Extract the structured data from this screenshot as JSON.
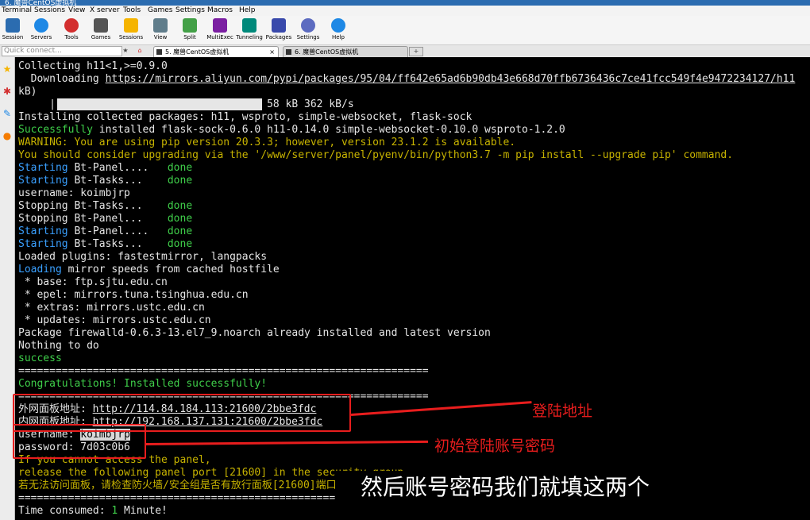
{
  "window": {
    "title": "6. 魔兽CentOS虚拟机"
  },
  "menu": [
    "Terminal",
    "Sessions",
    "View",
    "X server",
    "Tools",
    "Games",
    "Settings",
    "Macros",
    "Help"
  ],
  "toolbar": [
    {
      "label": "Session",
      "icon": "session-icon",
      "color": "#2b6cb0"
    },
    {
      "label": "Servers",
      "icon": "servers-icon",
      "color": "#1e88e5"
    },
    {
      "label": "Tools",
      "icon": "tools-icon",
      "color": "#d32f2f"
    },
    {
      "label": "Games",
      "icon": "games-icon",
      "color": "#555555"
    },
    {
      "label": "Sessions",
      "icon": "star-icon",
      "color": "#f5b400"
    },
    {
      "label": "View",
      "icon": "view-icon",
      "color": "#607d8b"
    },
    {
      "label": "Split",
      "icon": "split-icon",
      "color": "#43a047"
    },
    {
      "label": "MultiExec",
      "icon": "multiexec-icon",
      "color": "#7b1fa2"
    },
    {
      "label": "Tunneling",
      "icon": "tunneling-icon",
      "color": "#00897b"
    },
    {
      "label": "Packages",
      "icon": "packages-icon",
      "color": "#3949ab"
    },
    {
      "label": "Settings",
      "icon": "settings-icon",
      "color": "#5c6bc0"
    },
    {
      "label": "Help",
      "icon": "help-icon",
      "color": "#1e88e5"
    }
  ],
  "quick_connect": {
    "placeholder": "Quick connect..."
  },
  "tabs": [
    {
      "label": "5. 魔兽CentOS虚拟机",
      "active": true
    },
    {
      "label": "6. 魔兽CentOS虚拟机",
      "active": false
    }
  ],
  "terminal": {
    "lines": [
      {
        "text": "Collecting h11<1,>=0.9.0",
        "color": "w"
      },
      {
        "text": "  Downloading https://mirrors.aliyun.com/pypi/packages/95/04/ff642e65ad6b90db43e668d70ffb6736436c7ce41fcc549f4e9472234127/h11",
        "color": "w"
      },
      {
        "text": "kB)",
        "color": "w"
      },
      {
        "text": "     |                                | 58 kB 362 kB/s",
        "color": "w"
      },
      {
        "text": "Installing collected packages: h11, wsproto, simple-websocket, flask-sock",
        "color": "w"
      },
      {
        "text": "Successfully installed flask-sock-0.6.0 h11-0.14.0 simple-websocket-0.10.0 wsproto-1.2.0",
        "color": "w"
      },
      {
        "text": "WARNING: You are using pip version 20.3.3; however, version 23.1.2 is available.",
        "color": "y"
      },
      {
        "text": "You should consider upgrading via the '/www/server/panel/pyenv/bin/python3.7 -m pip install --upgrade pip' command.",
        "color": "y"
      },
      {
        "text": "Starting Bt-Panel....   done",
        "color": "w"
      },
      {
        "text": "Starting Bt-Tasks...    done",
        "color": "w"
      },
      {
        "text": "username: koimbjrp",
        "color": "w"
      },
      {
        "text": "Stopping Bt-Tasks...    done",
        "color": "w"
      },
      {
        "text": "Stopping Bt-Panel...    done",
        "color": "w"
      },
      {
        "text": "Starting Bt-Panel....   done",
        "color": "w"
      },
      {
        "text": "Starting Bt-Tasks...    done",
        "color": "w"
      },
      {
        "text": "Loaded plugins: fastestmirror, langpacks",
        "color": "w"
      },
      {
        "text": "Loading mirror speeds from cached hostfile",
        "color": "w"
      },
      {
        "text": " * base: ftp.sjtu.edu.cn",
        "color": "w"
      },
      {
        "text": " * epel: mirrors.tuna.tsinghua.edu.cn",
        "color": "w"
      },
      {
        "text": " * extras: mirrors.ustc.edu.cn",
        "color": "w"
      },
      {
        "text": " * updates: mirrors.ustc.edu.cn",
        "color": "w"
      },
      {
        "text": "Package firewalld-0.6.3-13.el7_9.noarch already installed and latest version",
        "color": "w"
      },
      {
        "text": "Nothing to do",
        "color": "w"
      },
      {
        "text": "success",
        "color": "g"
      },
      {
        "text": "==================================================================",
        "color": "w"
      },
      {
        "text": "Congratulations! Installed successfully!",
        "color": "g"
      },
      {
        "text": "==================================================================",
        "color": "w"
      },
      {
        "text": "外网面板地址: http://114.84.184.113:21600/2bbe3fdc",
        "color": "w"
      },
      {
        "text": "内网面板地址: http://192.168.137.131:21600/2bbe3fdc",
        "color": "w"
      },
      {
        "text": "username: koimbjrp",
        "color": "w"
      },
      {
        "text": "password: 7d03c0b6",
        "color": "w"
      },
      {
        "text": "If you cannot access the panel,",
        "color": "y"
      },
      {
        "text": "release the following panel port [21600] in the security group",
        "color": "y"
      },
      {
        "text": "若无法访问面板，请检查防火墙/安全组是否有放行面板[21600]端口",
        "color": "y"
      },
      {
        "text": "==================================================================",
        "color": "w"
      },
      {
        "text": "Time consumed: 1 Minute!",
        "color": "w"
      }
    ],
    "progress": 1.0
  },
  "annotations": {
    "address_label": "登陆地址",
    "account_label": "初始登陆账号密码",
    "color": "#e81d1d"
  },
  "subtitle": "然后账号密码我们就填这两个"
}
